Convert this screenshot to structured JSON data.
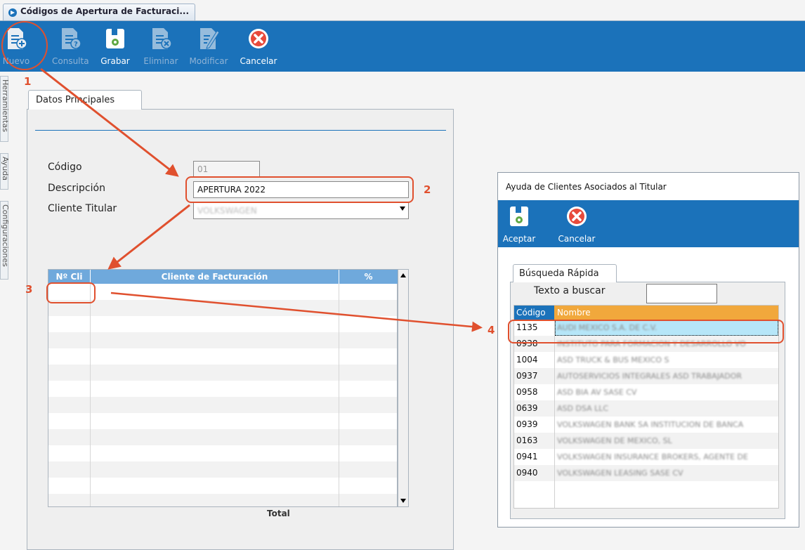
{
  "window": {
    "tab_title": "Códigos de Apertura de Facturaci..."
  },
  "toolbar": {
    "buttons": [
      {
        "label": "Nuevo",
        "enabled": true
      },
      {
        "label": "Consulta",
        "enabled": false
      },
      {
        "label": "Grabar",
        "enabled": true
      },
      {
        "label": "Eliminar",
        "enabled": false
      },
      {
        "label": "Modificar",
        "enabled": false
      },
      {
        "label": "Cancelar",
        "enabled": true
      }
    ]
  },
  "side_tabs": [
    "Herramientas",
    "Ayuda",
    "Configuraciones"
  ],
  "form": {
    "tab": "Datos Principales",
    "codigo_label": "Código",
    "codigo_value": "01",
    "descripcion_label": "Descripción",
    "descripcion_value": "APERTURA 2022",
    "cliente_label": "Cliente Titular",
    "cliente_value": "VOLKSWAGEN"
  },
  "grid": {
    "headers": [
      "Nº Cli",
      "Cliente de Facturación",
      "%"
    ],
    "total_label": "Total"
  },
  "annotations": [
    "1",
    "2",
    "3",
    "4"
  ],
  "dialog": {
    "title": "Ayuda de Clientes Asociados al Titular",
    "accept_label": "Aceptar",
    "cancel_label": "Cancelar",
    "tab": "Búsqueda Rápida",
    "search_label": "Texto a buscar",
    "search_value": "",
    "columns": [
      "Código",
      "Nombre"
    ],
    "rows": [
      {
        "code": "1135",
        "name": "AUDI MEXICO S.A. DE C.V."
      },
      {
        "code": "0938",
        "name": "INSTITUTO PARA FORMACION Y DESARROLLO VO"
      },
      {
        "code": "1004",
        "name": "ASD TRUCK & BUS MEXICO S"
      },
      {
        "code": "0937",
        "name": "AUTOSERVICIOS INTEGRALES ASD TRABAJADOR"
      },
      {
        "code": "0958",
        "name": "ASD BIA AV SASE CV"
      },
      {
        "code": "0639",
        "name": "ASD DSA LLC"
      },
      {
        "code": "0939",
        "name": "VOLKSWAGEN BANK SA INSTITUCION DE BANCA"
      },
      {
        "code": "0163",
        "name": "VOLKSWAGEN DE MEXICO, SL"
      },
      {
        "code": "0941",
        "name": "VOLKSWAGEN INSURANCE BROKERS, AGENTE DE"
      },
      {
        "code": "0940",
        "name": "VOLKSWAGEN LEASING SASE CV"
      }
    ],
    "selected_code": "1135"
  },
  "colors": {
    "toolbar": "#1b72ba",
    "annotation": "#e0502e",
    "selection": "#b6e6f8",
    "grid_header": "#6fa9dc",
    "dialog_header": "#f1a83c"
  }
}
